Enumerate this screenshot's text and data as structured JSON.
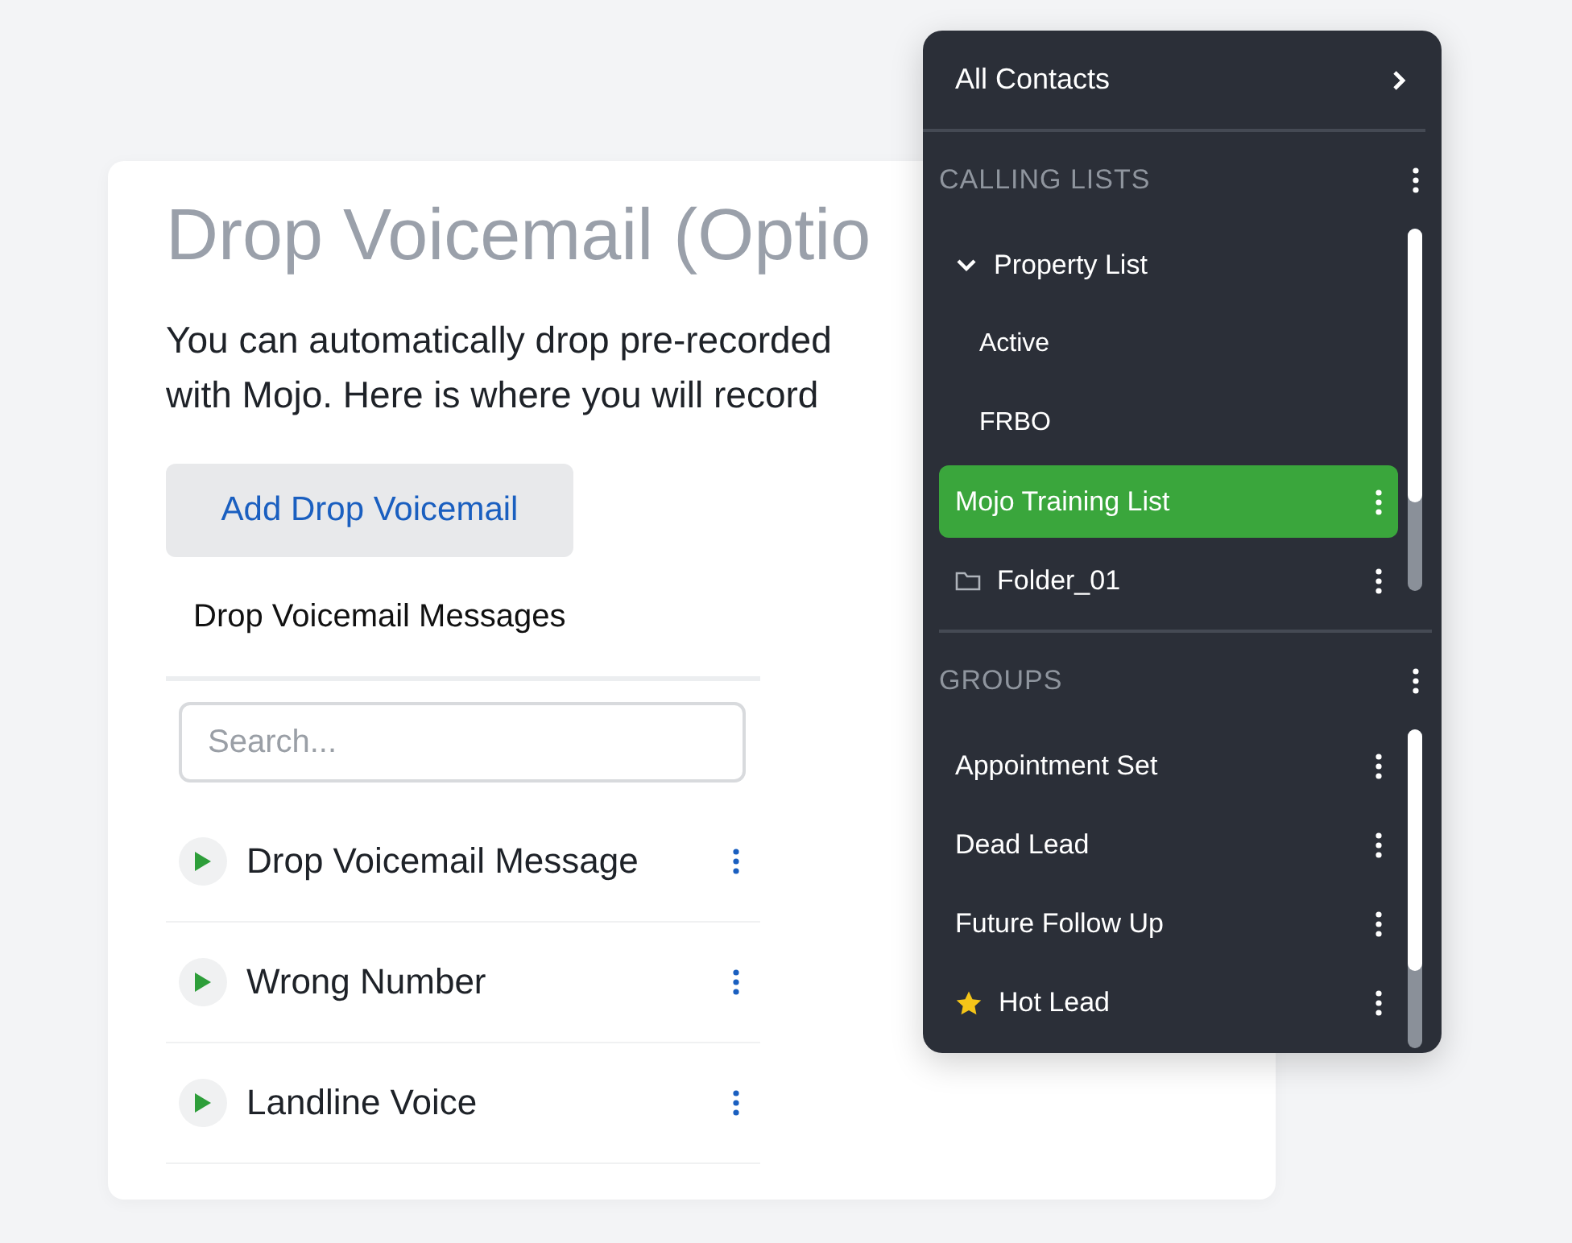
{
  "page": {
    "title": "Drop Voicemail (Optio",
    "description_lines": [
      "You can automatically drop pre-recorded",
      "with Mojo. Here is where you will record"
    ],
    "add_button": "Add Drop Voicemail",
    "list_title": "Drop Voicemail Messages",
    "search": {
      "placeholder": "Search..."
    },
    "messages": [
      {
        "name": "Drop Voicemail Message"
      },
      {
        "name": "Wrong Number"
      },
      {
        "name": "Landline Voice"
      }
    ]
  },
  "menu": {
    "all_contacts": "All Contacts",
    "sections": [
      {
        "title": "CALLING LISTS",
        "items": [
          {
            "kind": "list",
            "label": "Property List",
            "expanded": true,
            "selected": false,
            "has_menu": false,
            "starred": false,
            "children": [
              {
                "kind": "list",
                "label": "Active",
                "selected": false,
                "has_menu": false,
                "starred": false
              },
              {
                "kind": "list",
                "label": "FRBO",
                "selected": false,
                "has_menu": false,
                "starred": false
              }
            ]
          },
          {
            "kind": "list",
            "label": "Mojo Training List",
            "selected": true,
            "has_menu": true,
            "starred": false
          },
          {
            "kind": "folder",
            "label": "Folder_01",
            "selected": false,
            "has_menu": true,
            "starred": false
          }
        ]
      },
      {
        "title": "GROUPS",
        "items": [
          {
            "kind": "list",
            "label": "Appointment Set",
            "selected": false,
            "has_menu": true,
            "starred": false
          },
          {
            "kind": "list",
            "label": "Dead Lead",
            "selected": false,
            "has_menu": true,
            "starred": false
          },
          {
            "kind": "list",
            "label": "Future Follow Up",
            "selected": false,
            "has_menu": true,
            "starred": false
          },
          {
            "kind": "list",
            "label": "Hot Lead",
            "selected": false,
            "has_menu": true,
            "starred": true
          }
        ]
      }
    ]
  }
}
